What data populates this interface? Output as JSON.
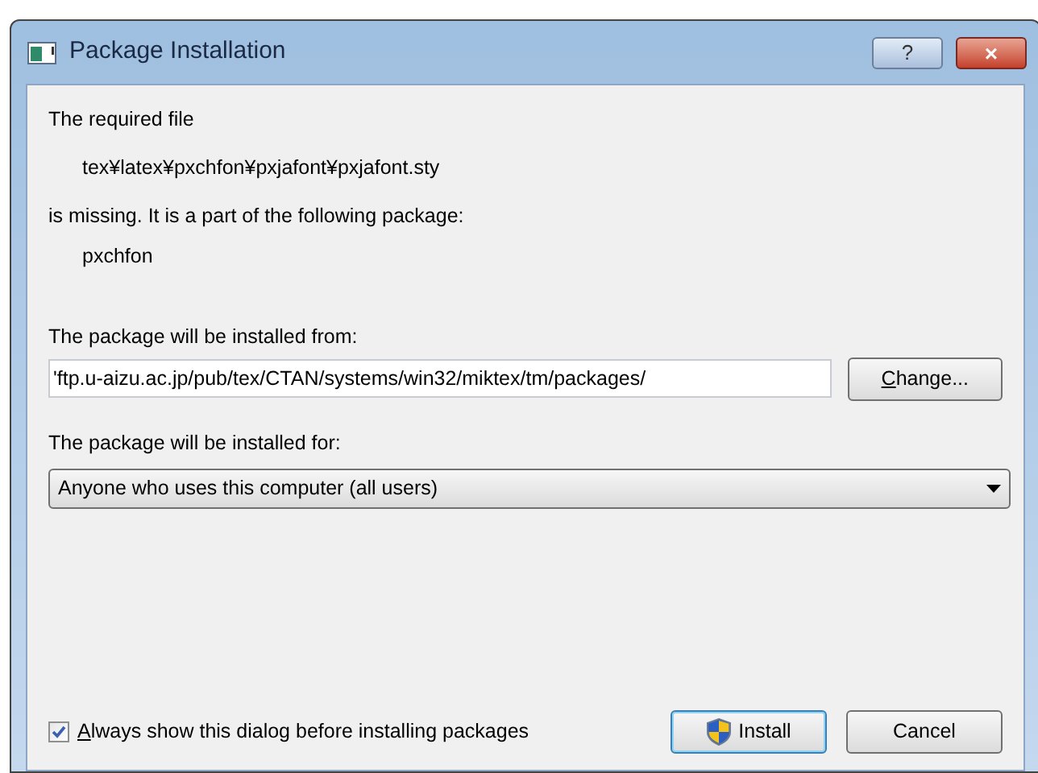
{
  "window": {
    "title": "Package Installation",
    "buttons": [
      "?",
      "×"
    ]
  },
  "message": {
    "intro": "The required file",
    "file": "tex¥latex¥pxchfon¥pxjafont¥pxjafont.sty",
    "missing": "is missing. It is a part of the following package:",
    "package": "pxchfon"
  },
  "source": {
    "label": "The package will be installed from:",
    "value": "'ftp.u-aizu.ac.jp/pub/tex/CTAN/systems/win32/miktex/tm/packages/",
    "button": "Change..."
  },
  "target": {
    "label": "The package will be installed for:",
    "value": "Anyone who uses this computer (all users)"
  },
  "always_show": {
    "label": "Always show this dialog before installing packages",
    "checked": true
  },
  "buttons": [
    {
      "label": "Install",
      "kind": "shield",
      "default": true
    },
    {
      "label": "Cancel",
      "kind": "plain",
      "default": false
    }
  ]
}
